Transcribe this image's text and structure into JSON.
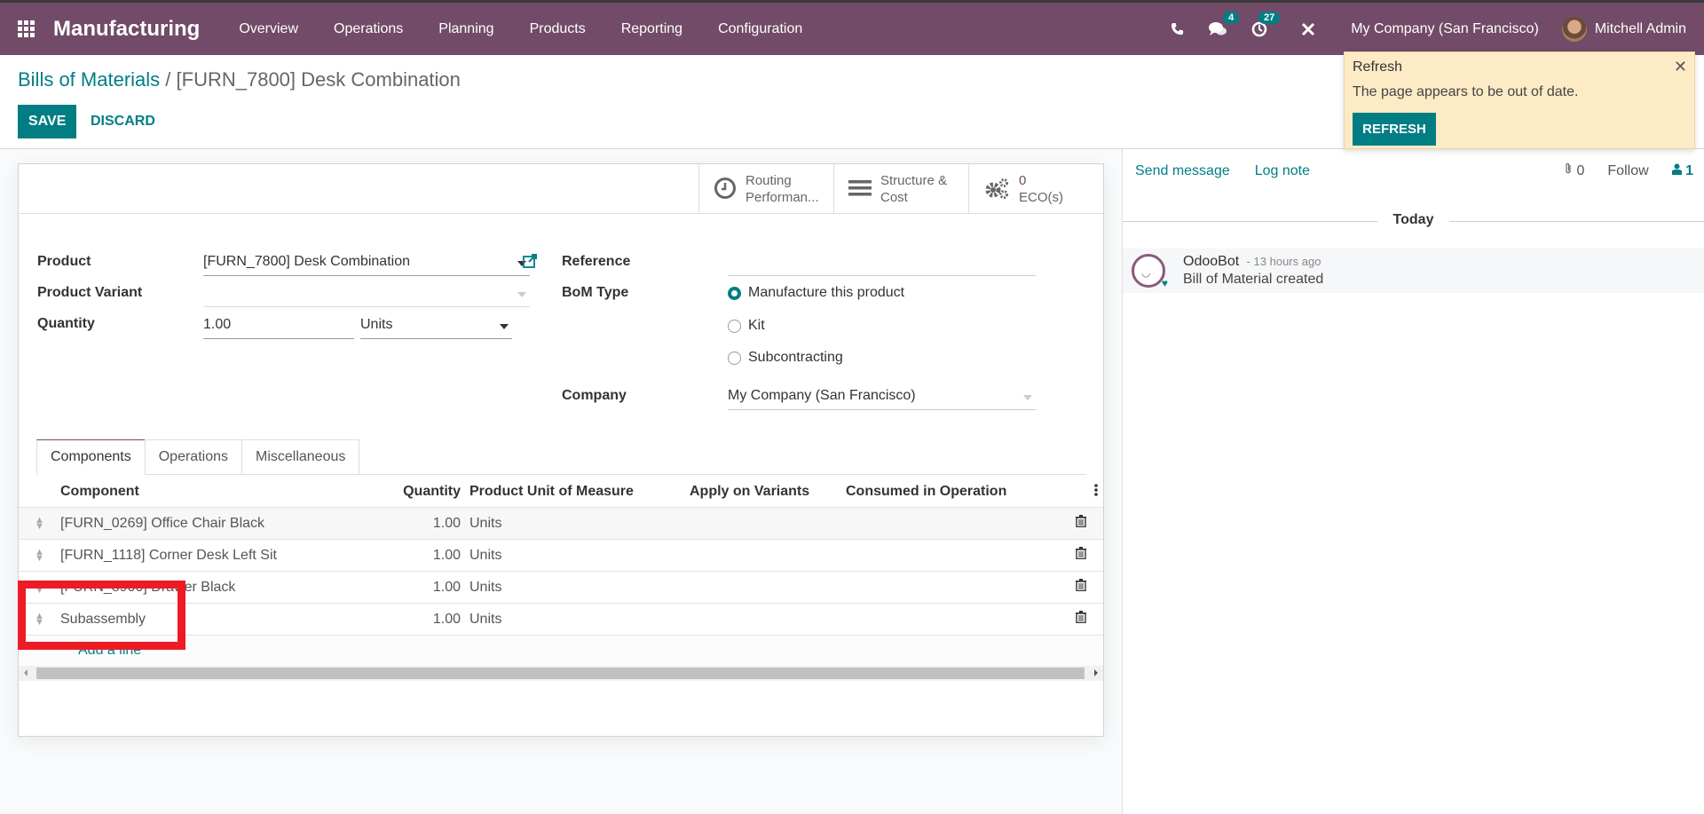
{
  "navbar": {
    "app_name": "Manufacturing",
    "menu": [
      "Overview",
      "Operations",
      "Planning",
      "Products",
      "Reporting",
      "Configuration"
    ],
    "messages_count": "4",
    "activities_count": "27",
    "company": "My Company (San Francisco)",
    "user": "Mitchell Admin"
  },
  "breadcrumb": {
    "parent": "Bills of Materials",
    "separator": "/",
    "current": "[FURN_7800] Desk Combination"
  },
  "actions": {
    "save_label": "SAVE",
    "discard_label": "DISCARD"
  },
  "stat_buttons": [
    {
      "icon": "clock-icon",
      "line1": "Routing",
      "line2": "Performan..."
    },
    {
      "icon": "bars-icon",
      "line1": "Structure &",
      "line2": "Cost"
    },
    {
      "icon": "cogs-icon",
      "value": "0",
      "label": "ECO(s)"
    }
  ],
  "form": {
    "product_label": "Product",
    "product_value": "[FURN_7800] Desk Combination",
    "variant_label": "Product Variant",
    "variant_value": "",
    "quantity_label": "Quantity",
    "quantity_value": "1.00",
    "quantity_uom": "Units",
    "reference_label": "Reference",
    "reference_value": "",
    "bom_type_label": "BoM Type",
    "bom_type_options": [
      "Manufacture this product",
      "Kit",
      "Subcontracting"
    ],
    "bom_type_selected": "Manufacture this product",
    "company_label": "Company",
    "company_value": "My Company (San Francisco)"
  },
  "tabs": [
    {
      "label": "Components",
      "active": true
    },
    {
      "label": "Operations",
      "active": false
    },
    {
      "label": "Miscellaneous",
      "active": false
    }
  ],
  "components_table": {
    "columns": [
      "Component",
      "Quantity",
      "Product Unit of Measure",
      "Apply on Variants",
      "Consumed in Operation"
    ],
    "rows": [
      {
        "component": "[FURN_0269] Office Chair Black",
        "quantity": "1.00",
        "uom": "Units",
        "variants": "",
        "operation": ""
      },
      {
        "component": "[FURN_1118] Corner Desk Left Sit",
        "quantity": "1.00",
        "uom": "Units",
        "variants": "",
        "operation": ""
      },
      {
        "component": "[FURN_8900] Drawer Black",
        "quantity": "1.00",
        "uom": "Units",
        "variants": "",
        "operation": ""
      },
      {
        "component": "Subassembly",
        "quantity": "1.00",
        "uom": "Units",
        "variants": "",
        "operation": ""
      }
    ],
    "add_line_label": "Add a line"
  },
  "chatter": {
    "send_message": "Send message",
    "log_note": "Log note",
    "attachments_count": "0",
    "follow_label": "Follow",
    "followers_count": "1",
    "date_divider": "Today",
    "messages": [
      {
        "author": "OdooBot",
        "date": "- 13 hours ago",
        "body": "Bill of Material created"
      }
    ]
  },
  "notification": {
    "title": "Refresh",
    "message": "The page appears to be out of date.",
    "button_label": "REFRESH"
  },
  "colors": {
    "brand": "#714b67",
    "primary": "#017e84",
    "highlight": "#ed1c24",
    "notification_bg": "#fdebc6"
  }
}
